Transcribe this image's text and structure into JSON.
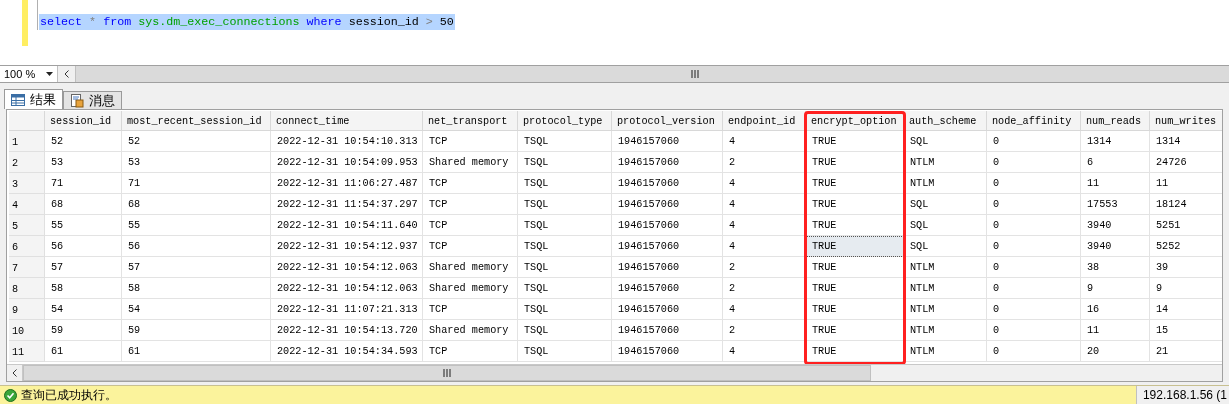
{
  "editor": {
    "tokens": [
      {
        "text": "select",
        "kind": "keyword"
      },
      {
        "text": "*",
        "kind": "operator"
      },
      {
        "text": "from",
        "kind": "keyword"
      },
      {
        "text": "sys.dm_exec_connections",
        "kind": "object"
      },
      {
        "text": "where",
        "kind": "keyword"
      },
      {
        "text": "session_id",
        "kind": "identifier"
      },
      {
        "text": ">",
        "kind": "operator"
      },
      {
        "text": "50",
        "kind": "identifier"
      }
    ]
  },
  "zoom": {
    "value": "100 %"
  },
  "result_tabs": [
    {
      "label": "结果",
      "kind": "grid",
      "selected": true
    },
    {
      "label": "消息",
      "kind": "message",
      "selected": false
    }
  ],
  "table": {
    "columns": [
      {
        "label": "session_id",
        "highlighted": false
      },
      {
        "label": "most_recent_session_id",
        "highlighted": false
      },
      {
        "label": "connect_time",
        "highlighted": false
      },
      {
        "label": "net_transport",
        "highlighted": false
      },
      {
        "label": "protocol_type",
        "highlighted": false
      },
      {
        "label": "protocol_version",
        "highlighted": false
      },
      {
        "label": "endpoint_id",
        "highlighted": false
      },
      {
        "label": "encrypt_option",
        "highlighted": true
      },
      {
        "label": "auth_scheme",
        "highlighted": false
      },
      {
        "label": "node_affinity",
        "highlighted": false
      },
      {
        "label": "num_reads",
        "highlighted": false
      },
      {
        "label": "num_writes",
        "highlighted": false
      }
    ],
    "rows": [
      {
        "number": "1",
        "cells": [
          {
            "text": "52",
            "selected": false
          },
          {
            "text": "52",
            "selected": false
          },
          {
            "text": "2022-12-31 10:54:10.313",
            "selected": false
          },
          {
            "text": "TCP",
            "selected": false
          },
          {
            "text": "TSQL",
            "selected": false
          },
          {
            "text": "1946157060",
            "selected": false
          },
          {
            "text": "4",
            "selected": false
          },
          {
            "text": "TRUE",
            "selected": false
          },
          {
            "text": "SQL",
            "selected": false
          },
          {
            "text": "0",
            "selected": false
          },
          {
            "text": "1314",
            "selected": false
          },
          {
            "text": "1314",
            "selected": false
          }
        ]
      },
      {
        "number": "2",
        "cells": [
          {
            "text": "53",
            "selected": false
          },
          {
            "text": "53",
            "selected": false
          },
          {
            "text": "2022-12-31 10:54:09.953",
            "selected": false
          },
          {
            "text": "Shared memory",
            "selected": false
          },
          {
            "text": "TSQL",
            "selected": false
          },
          {
            "text": "1946157060",
            "selected": false
          },
          {
            "text": "2",
            "selected": false
          },
          {
            "text": "TRUE",
            "selected": false
          },
          {
            "text": "NTLM",
            "selected": false
          },
          {
            "text": "0",
            "selected": false
          },
          {
            "text": "6",
            "selected": false
          },
          {
            "text": "24726",
            "selected": false
          }
        ]
      },
      {
        "number": "3",
        "cells": [
          {
            "text": "71",
            "selected": false
          },
          {
            "text": "71",
            "selected": false
          },
          {
            "text": "2022-12-31 11:06:27.487",
            "selected": false
          },
          {
            "text": "TCP",
            "selected": false
          },
          {
            "text": "TSQL",
            "selected": false
          },
          {
            "text": "1946157060",
            "selected": false
          },
          {
            "text": "4",
            "selected": false
          },
          {
            "text": "TRUE",
            "selected": false
          },
          {
            "text": "NTLM",
            "selected": false
          },
          {
            "text": "0",
            "selected": false
          },
          {
            "text": "11",
            "selected": false
          },
          {
            "text": "11",
            "selected": false
          }
        ]
      },
      {
        "number": "4",
        "cells": [
          {
            "text": "68",
            "selected": false
          },
          {
            "text": "68",
            "selected": false
          },
          {
            "text": "2022-12-31 11:54:37.297",
            "selected": false
          },
          {
            "text": "TCP",
            "selected": false
          },
          {
            "text": "TSQL",
            "selected": false
          },
          {
            "text": "1946157060",
            "selected": false
          },
          {
            "text": "4",
            "selected": false
          },
          {
            "text": "TRUE",
            "selected": false
          },
          {
            "text": "SQL",
            "selected": false
          },
          {
            "text": "0",
            "selected": false
          },
          {
            "text": "17553",
            "selected": false
          },
          {
            "text": "18124",
            "selected": false
          }
        ]
      },
      {
        "number": "5",
        "cells": [
          {
            "text": "55",
            "selected": false
          },
          {
            "text": "55",
            "selected": false
          },
          {
            "text": "2022-12-31 10:54:11.640",
            "selected": false
          },
          {
            "text": "TCP",
            "selected": false
          },
          {
            "text": "TSQL",
            "selected": false
          },
          {
            "text": "1946157060",
            "selected": false
          },
          {
            "text": "4",
            "selected": false
          },
          {
            "text": "TRUE",
            "selected": false
          },
          {
            "text": "SQL",
            "selected": false
          },
          {
            "text": "0",
            "selected": false
          },
          {
            "text": "3940",
            "selected": false
          },
          {
            "text": "5251",
            "selected": false
          }
        ]
      },
      {
        "number": "6",
        "cells": [
          {
            "text": "56",
            "selected": false
          },
          {
            "text": "56",
            "selected": false
          },
          {
            "text": "2022-12-31 10:54:12.937",
            "selected": false
          },
          {
            "text": "TCP",
            "selected": false
          },
          {
            "text": "TSQL",
            "selected": false
          },
          {
            "text": "1946157060",
            "selected": false
          },
          {
            "text": "4",
            "selected": false
          },
          {
            "text": "TRUE",
            "selected": true
          },
          {
            "text": "SQL",
            "selected": false
          },
          {
            "text": "0",
            "selected": false
          },
          {
            "text": "3940",
            "selected": false
          },
          {
            "text": "5252",
            "selected": false
          }
        ]
      },
      {
        "number": "7",
        "cells": [
          {
            "text": "57",
            "selected": false
          },
          {
            "text": "57",
            "selected": false
          },
          {
            "text": "2022-12-31 10:54:12.063",
            "selected": false
          },
          {
            "text": "Shared memory",
            "selected": false
          },
          {
            "text": "TSQL",
            "selected": false
          },
          {
            "text": "1946157060",
            "selected": false
          },
          {
            "text": "2",
            "selected": false
          },
          {
            "text": "TRUE",
            "selected": false
          },
          {
            "text": "NTLM",
            "selected": false
          },
          {
            "text": "0",
            "selected": false
          },
          {
            "text": "38",
            "selected": false
          },
          {
            "text": "39",
            "selected": false
          }
        ]
      },
      {
        "number": "8",
        "cells": [
          {
            "text": "58",
            "selected": false
          },
          {
            "text": "58",
            "selected": false
          },
          {
            "text": "2022-12-31 10:54:12.063",
            "selected": false
          },
          {
            "text": "Shared memory",
            "selected": false
          },
          {
            "text": "TSQL",
            "selected": false
          },
          {
            "text": "1946157060",
            "selected": false
          },
          {
            "text": "2",
            "selected": false
          },
          {
            "text": "TRUE",
            "selected": false
          },
          {
            "text": "NTLM",
            "selected": false
          },
          {
            "text": "0",
            "selected": false
          },
          {
            "text": "9",
            "selected": false
          },
          {
            "text": "9",
            "selected": false
          }
        ]
      },
      {
        "number": "9",
        "cells": [
          {
            "text": "54",
            "selected": false
          },
          {
            "text": "54",
            "selected": false
          },
          {
            "text": "2022-12-31 11:07:21.313",
            "selected": false
          },
          {
            "text": "TCP",
            "selected": false
          },
          {
            "text": "TSQL",
            "selected": false
          },
          {
            "text": "1946157060",
            "selected": false
          },
          {
            "text": "4",
            "selected": false
          },
          {
            "text": "TRUE",
            "selected": false
          },
          {
            "text": "NTLM",
            "selected": false
          },
          {
            "text": "0",
            "selected": false
          },
          {
            "text": "16",
            "selected": false
          },
          {
            "text": "14",
            "selected": false
          }
        ]
      },
      {
        "number": "10",
        "cells": [
          {
            "text": "59",
            "selected": false
          },
          {
            "text": "59",
            "selected": false
          },
          {
            "text": "2022-12-31 10:54:13.720",
            "selected": false
          },
          {
            "text": "Shared memory",
            "selected": false
          },
          {
            "text": "TSQL",
            "selected": false
          },
          {
            "text": "1946157060",
            "selected": false
          },
          {
            "text": "2",
            "selected": false
          },
          {
            "text": "TRUE",
            "selected": false
          },
          {
            "text": "NTLM",
            "selected": false
          },
          {
            "text": "0",
            "selected": false
          },
          {
            "text": "11",
            "selected": false
          },
          {
            "text": "15",
            "selected": false
          }
        ]
      },
      {
        "number": "11",
        "cells": [
          {
            "text": "61",
            "selected": false
          },
          {
            "text": "61",
            "selected": false
          },
          {
            "text": "2022-12-31 10:54:34.593",
            "selected": false
          },
          {
            "text": "TCP",
            "selected": false
          },
          {
            "text": "TSQL",
            "selected": false
          },
          {
            "text": "1946157060",
            "selected": false
          },
          {
            "text": "4",
            "selected": false
          },
          {
            "text": "TRUE",
            "selected": false
          },
          {
            "text": "NTLM",
            "selected": false
          },
          {
            "text": "0",
            "selected": false
          },
          {
            "text": "20",
            "selected": false
          },
          {
            "text": "21",
            "selected": false
          }
        ]
      }
    ]
  },
  "status_bar": {
    "message": "查询已成功执行。",
    "server": "192.168.1.56 (1"
  }
}
